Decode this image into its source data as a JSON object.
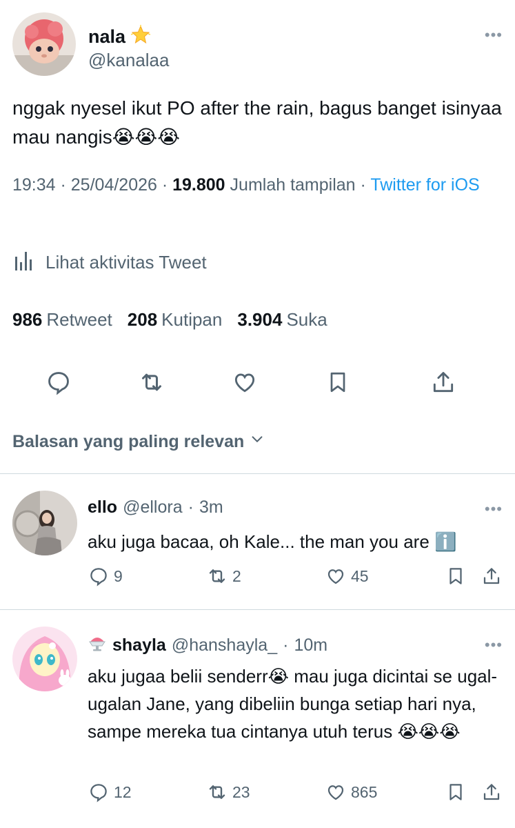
{
  "tweet": {
    "name": "nala",
    "badge_icon": "glowing-star",
    "handle": "@kanalaa",
    "text": "nggak nyesel ikut PO after the rain, bagus banget isinyaa mau nangis😭😭😭",
    "time": "19:34",
    "date": "25/04/2026",
    "views": "19.800",
    "views_label": "Jumlah tampilan",
    "source": "Twitter for iOS",
    "activity_label": "Lihat aktivitas Tweet",
    "retweets": "986",
    "retweets_label": "Retweet",
    "quotes": "208",
    "quotes_label": "Kutipan",
    "likes": "3.904",
    "likes_label": "Suka"
  },
  "replies_header": "Balasan yang paling relevan",
  "replies": [
    {
      "name": "ello",
      "handle": "@ellora",
      "time": "3m",
      "text": "aku juga bacaa, oh Kale... the man you are ℹ️",
      "replies": "9",
      "retweets": "2",
      "likes": "45"
    },
    {
      "name": "shayla",
      "name_prefix_icon": "shaved-ice",
      "handle": "@hanshayla_",
      "time": "10m",
      "text": "aku jugaa belii senderr😭 mau juga dicintai se ugal-ugalan Jane, yang dibeliin bunga setiap hari nya, sampe mereka tua cintanya utuh terus 😭😭😭",
      "replies": "12",
      "retweets": "23",
      "likes": "865"
    }
  ],
  "colors": {
    "text": "#0f1419",
    "secondary": "#536471",
    "link": "#1d9bf0",
    "divider": "#cfd9de"
  }
}
